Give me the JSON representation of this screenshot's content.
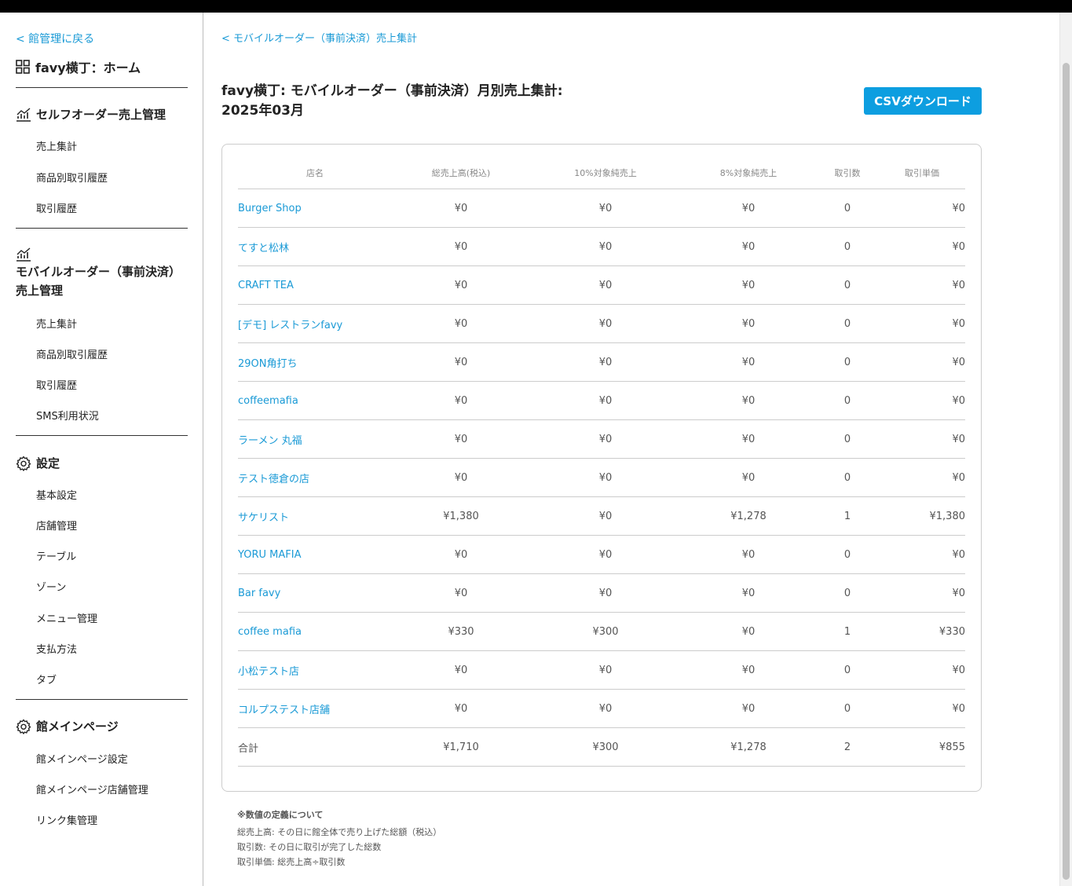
{
  "sidebar": {
    "back_label": "< 館管理に戻る",
    "home_label": "favy横丁：ホーム",
    "sections": [
      {
        "title": "セルフオーダー売上管理",
        "items": [
          "売上集計",
          "商品別取引履歴",
          "取引履歴"
        ]
      },
      {
        "title_lines": [
          "モバイルオーダー（事前決済）",
          "売上管理"
        ],
        "items": [
          "売上集計",
          "商品別取引履歴",
          "取引履歴",
          "SMS利用状況"
        ]
      },
      {
        "title": "設定",
        "items": [
          "基本設定",
          "店舗管理",
          "テーブル",
          "ゾーン",
          "メニュー管理",
          "支払方法",
          "タブ"
        ]
      },
      {
        "title": "館メインページ",
        "items": [
          "館メインページ設定",
          "館メインページ店舗管理",
          "リンク集管理"
        ]
      }
    ]
  },
  "breadcrumb": "< モバイルオーダー（事前決済）売上集計",
  "title_line1": "favy横丁: モバイルオーダー（事前決済）月別売上集計:",
  "title_line2": "2025年03月",
  "csv_button": "CSVダウンロード",
  "table": {
    "headers": [
      "店名",
      "総売上高(税込)",
      "10%対象純売上",
      "8%対象純売上",
      "取引数",
      "取引単価"
    ],
    "rows": [
      [
        "Burger Shop",
        "¥0",
        "¥0",
        "¥0",
        "0",
        "¥0"
      ],
      [
        "てすと松林",
        "¥0",
        "¥0",
        "¥0",
        "0",
        "¥0"
      ],
      [
        "CRAFT TEA",
        "¥0",
        "¥0",
        "¥0",
        "0",
        "¥0"
      ],
      [
        "[デモ] レストランfavy",
        "¥0",
        "¥0",
        "¥0",
        "0",
        "¥0"
      ],
      [
        "29ON角打ち",
        "¥0",
        "¥0",
        "¥0",
        "0",
        "¥0"
      ],
      [
        "coffeemafia",
        "¥0",
        "¥0",
        "¥0",
        "0",
        "¥0"
      ],
      [
        "ラーメン 丸福",
        "¥0",
        "¥0",
        "¥0",
        "0",
        "¥0"
      ],
      [
        "テスト徳倉の店",
        "¥0",
        "¥0",
        "¥0",
        "0",
        "¥0"
      ],
      [
        "サケリスト",
        "¥1,380",
        "¥0",
        "¥1,278",
        "1",
        "¥1,380"
      ],
      [
        "YORU MAFIA",
        "¥0",
        "¥0",
        "¥0",
        "0",
        "¥0"
      ],
      [
        "Bar favy",
        "¥0",
        "¥0",
        "¥0",
        "0",
        "¥0"
      ],
      [
        "coffee mafia",
        "¥330",
        "¥300",
        "¥0",
        "1",
        "¥330"
      ],
      [
        "小松テスト店",
        "¥0",
        "¥0",
        "¥0",
        "0",
        "¥0"
      ],
      [
        "コルプステスト店舗",
        "¥0",
        "¥0",
        "¥0",
        "0",
        "¥0"
      ]
    ],
    "total": [
      "合計",
      "¥1,710",
      "¥300",
      "¥1,278",
      "2",
      "¥855"
    ]
  },
  "notes": {
    "title": "※数値の定義について",
    "lines": [
      "総売上高: その日に館全体で売り上げた総額（税込）",
      "取引数: その日に取引が完了した総数",
      "取引単価: 総売上高÷取引数"
    ]
  },
  "colors": {
    "link": "#1a9ad6",
    "button": "#0d9ee0"
  }
}
